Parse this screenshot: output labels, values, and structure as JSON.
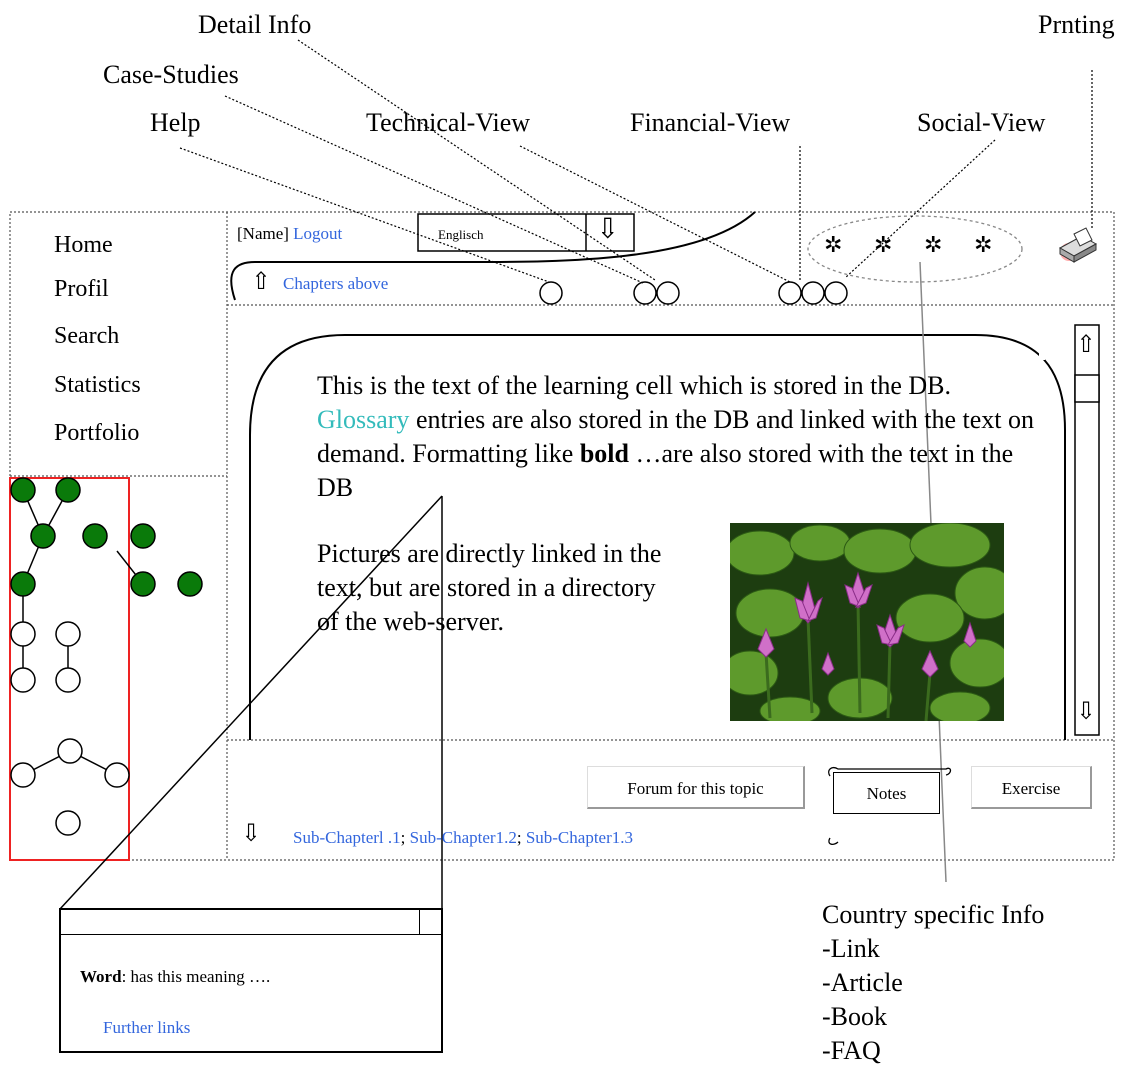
{
  "callouts": {
    "detail_info": "Detail Info",
    "printing": "Prnting",
    "case_studies": "Case-Studies",
    "help": "Help",
    "technical_view": "Technical-View",
    "financial_view": "Financial-View",
    "social_view": "Social-View"
  },
  "sidebar": {
    "items": [
      "Home",
      "Profil",
      "Search",
      "Statistics",
      "Portfolio"
    ]
  },
  "header": {
    "name": "[Name]",
    "logout": "Logout",
    "language": "Englisch",
    "chapters_above": "Chapters above"
  },
  "content": {
    "para1_a": "This is the text of the learning cell which is stored in the DB. ",
    "glossary_link": "Glossary",
    "para1_b": " entries are also stored in the DB and linked with the text on demand. Formatting like ",
    "bold_word": "bold",
    "para1_c": " …are also stored with the text in the DB",
    "para2": "Pictures are directly linked in the text, but are stored in a directory of the web-server."
  },
  "buttons": {
    "forum": "Forum for this topic",
    "notes": "Notes",
    "exercise": "Exercise"
  },
  "subchapters": {
    "sub1": "Sub-Chapterl .1",
    "sub2": "Sub-Chapter1.2",
    "sub3": "Sub-Chapter1.3",
    "sep": ";"
  },
  "glossary_popup": {
    "word": "Word",
    "meaning": ": has this meaning ….",
    "further_links": "Further links"
  },
  "country_info": {
    "title": "Country specific Info",
    "items": [
      "-Link",
      "-Article",
      "-Book",
      "-FAQ"
    ]
  },
  "colors": {
    "link": "#3366dd",
    "glossary": "#33bbbb",
    "tree_node": "#0a7a0a",
    "tree_frame": "#ee2222"
  },
  "icons": [
    "up-arrow-icon",
    "down-arrow-icon",
    "gear-icon",
    "printer-icon",
    "water-lily-image"
  ]
}
